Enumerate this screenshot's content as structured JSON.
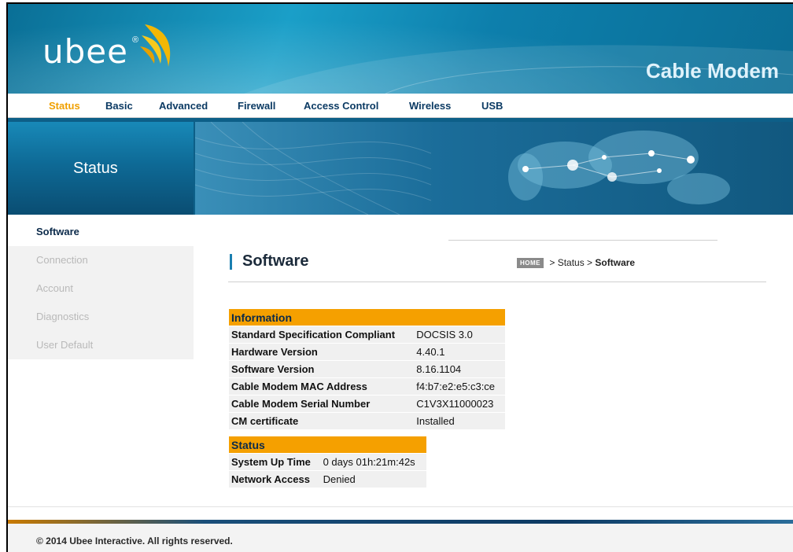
{
  "header": {
    "logo_text": "ubee",
    "logo_reg": "®",
    "product_title": "Cable Modem"
  },
  "nav": {
    "items": [
      {
        "label": "Status",
        "active": true
      },
      {
        "label": "Basic",
        "active": false
      },
      {
        "label": "Advanced",
        "active": false
      },
      {
        "label": "Firewall",
        "active": false
      },
      {
        "label": "Access Control",
        "active": false
      },
      {
        "label": "Wireless",
        "active": false
      },
      {
        "label": "USB",
        "active": false
      }
    ]
  },
  "banner": {
    "title": "Status",
    "image_icon": "world-map-network-icon"
  },
  "sidebar": {
    "items": [
      {
        "label": "Software",
        "active": true
      },
      {
        "label": "Connection",
        "active": false
      },
      {
        "label": "Account",
        "active": false
      },
      {
        "label": "Diagnostics",
        "active": false
      },
      {
        "label": "User Default",
        "active": false
      }
    ]
  },
  "main": {
    "page_title": "Software",
    "breadcrumb": {
      "home_badge": "HOME",
      "sep1": " > ",
      "item1": "Status",
      "sep2": " > ",
      "item2": "Software"
    },
    "information": {
      "heading": "Information",
      "rows": [
        {
          "label": "Standard Specification Compliant",
          "value": "DOCSIS 3.0"
        },
        {
          "label": "Hardware Version",
          "value": "4.40.1"
        },
        {
          "label": "Software Version",
          "value": "8.16.1104"
        },
        {
          "label": "Cable Modem MAC Address",
          "value": "f4:b7:e2:e5:c3:ce"
        },
        {
          "label": "Cable Modem Serial Number",
          "value": "C1V3X11000023"
        },
        {
          "label": "CM certificate",
          "value": "Installed"
        }
      ]
    },
    "status": {
      "heading": "Status",
      "rows": [
        {
          "label": "System Up Time",
          "value": "0 days 01h:21m:42s"
        },
        {
          "label": "Network Access",
          "value": "Denied"
        }
      ]
    }
  },
  "footer": {
    "copyright": "© 2014 Ubee Interactive. All rights reserved."
  },
  "colors": {
    "accent_orange": "#f5a000",
    "header_blue": "#0d7fac",
    "nav_text": "#0b3a63"
  }
}
